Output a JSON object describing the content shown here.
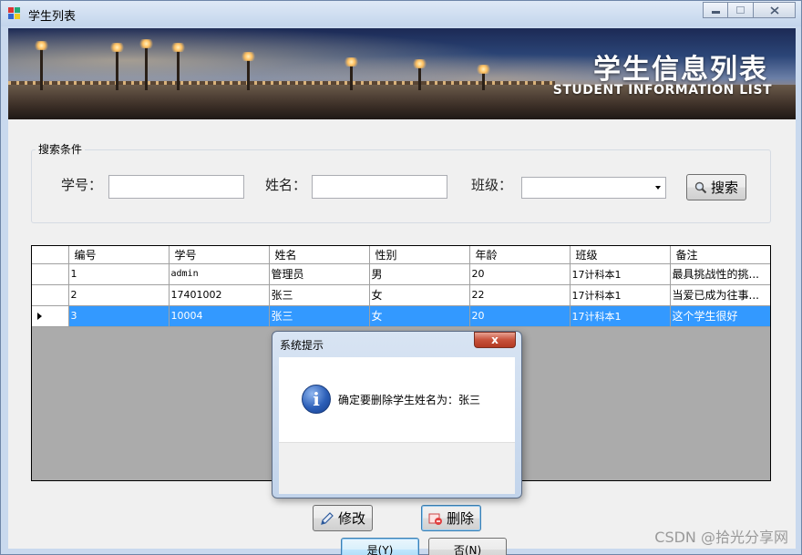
{
  "window": {
    "title": "学生列表",
    "minimize_icon": "minimize-icon",
    "maximize_icon": "maximize-icon",
    "close_icon": "close-icon"
  },
  "banner": {
    "title_cn": "学生信息列表",
    "title_en": "STUDENT INFORMATION LIST"
  },
  "search": {
    "group_title": "搜索条件",
    "student_no_label": "学号：",
    "student_no_value": "",
    "name_label": "姓名：",
    "name_value": "",
    "class_label": "班级：",
    "class_value": "",
    "search_button": "搜索"
  },
  "grid": {
    "columns": [
      "编号",
      "学号",
      "姓名",
      "性别",
      "年龄",
      "班级",
      "备注"
    ],
    "rows": [
      [
        "1",
        "admin",
        "管理员",
        "男",
        "20",
        "17计科本1",
        "最具挑战性的挑..."
      ],
      [
        "2",
        "17401002",
        "张三",
        "女",
        "22",
        "17计科本1",
        "当爱已成为往事..."
      ],
      [
        "3",
        "10004",
        "张三",
        "女",
        "20",
        "17计科本1",
        "这个学生很好"
      ]
    ],
    "selected_row": 3
  },
  "actions": {
    "edit_button": "修改",
    "delete_button": "删除"
  },
  "dialog": {
    "title": "系统提示",
    "close_glyph": "x",
    "icon": "info-icon",
    "message": "确定要删除学生姓名为：张三",
    "yes_button": "是(Y)",
    "no_button": "否(N)"
  },
  "watermark": "CSDN @拾光分享网",
  "colors": {
    "selection": "#3399ff",
    "titlebar": "#c9d9ee"
  }
}
